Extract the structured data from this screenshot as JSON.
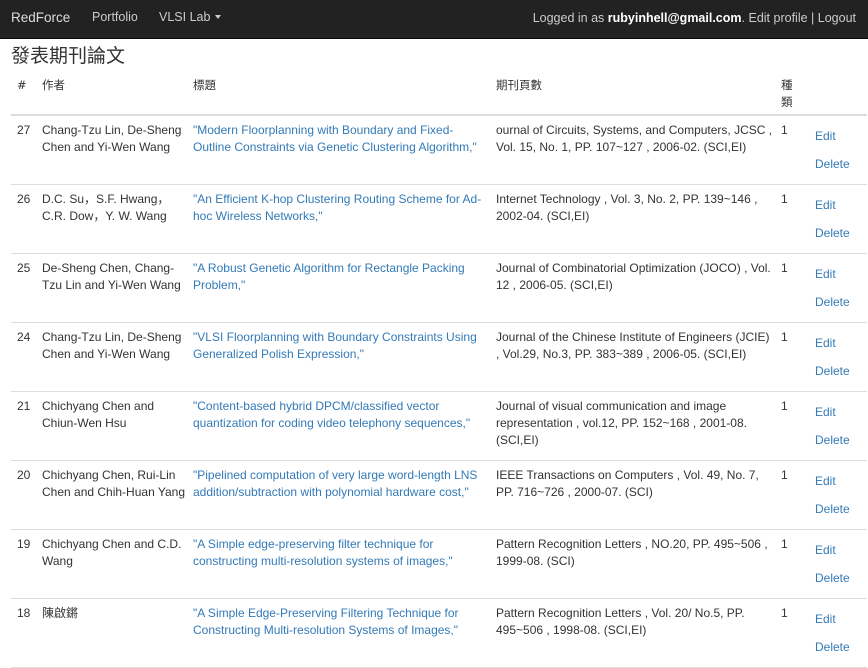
{
  "navbar": {
    "brand": "RedForce",
    "portfolio": "Portfolio",
    "vlsi_lab": "VLSI Lab",
    "logged_in_prefix": "Logged in as",
    "email": "rubyinhell@gmail.com",
    "period": ".",
    "edit_profile": "Edit profile",
    "separator": "|",
    "logout": "Logout"
  },
  "page": {
    "title": "發表期刊論文"
  },
  "table": {
    "headers": {
      "num": "#",
      "author": "作者",
      "title": "標題",
      "journal": "期刊頁數",
      "type_line1": "種",
      "type_line2": "類"
    },
    "rows": [
      {
        "num": "27",
        "author": "Chang-Tzu Lin, De-Sheng Chen and Yi-Wen Wang",
        "title": "\"Modern Floorplanning with Boundary and Fixed-Outline Constraints via Genetic Clustering Algorithm,\"",
        "journal": "ournal of Circuits, Systems, and Computers, JCSC , Vol. 15, No. 1, PP. 107~127 , 2006-02. (SCI,EI)",
        "type": "1",
        "edit": "Edit",
        "delete": "Delete"
      },
      {
        "num": "26",
        "author": "D.C. Su，S.F. Hwang，C.R. Dow，Y. W. Wang",
        "title": "\"An Efficient K-hop Clustering Routing Scheme for Ad-hoc Wireless Networks,\"",
        "journal": "Internet Technology , Vol. 3, No. 2, PP. 139~146 , 2002-04. (SCI,EI)",
        "type": "1",
        "edit": "Edit",
        "delete": "Delete"
      },
      {
        "num": "25",
        "author": "De-Sheng Chen, Chang-Tzu Lin and Yi-Wen Wang",
        "title": "\"A Robust Genetic Algorithm for Rectangle Packing Problem,\"",
        "journal": "Journal of Combinatorial Optimization (JOCO) , Vol. 12 , 2006-05. (SCI,EI)",
        "type": "1",
        "edit": "Edit",
        "delete": "Delete"
      },
      {
        "num": "24",
        "author": "Chang-Tzu Lin, De-Sheng Chen and Yi-Wen Wang",
        "title": "\"VLSI Floorplanning with Boundary Constraints Using Generalized Polish Expression,\"",
        "journal": "Journal of the Chinese Institute of Engineers (JCIE) , Vol.29, No.3, PP. 383~389 , 2006-05. (SCI,EI)",
        "type": "1",
        "edit": "Edit",
        "delete": "Delete"
      },
      {
        "num": "21",
        "author": "Chichyang Chen and Chiun-Wen Hsu",
        "title": "\"Content-based hybrid DPCM/classified vector quantization for coding video telephony sequences,\"",
        "journal": "Journal of visual communication and image representation , vol.12, PP. 152~168 , 2001-08. (SCI,EI)",
        "type": "1",
        "edit": "Edit",
        "delete": "Delete"
      },
      {
        "num": "20",
        "author": "Chichyang Chen, Rui-Lin Chen and Chih-Huan Yang",
        "title": "\"Pipelined computation of very large word-length LNS addition/subtraction with polynomial hardware cost,\"",
        "journal": "IEEE Transactions on Computers , Vol. 49, No. 7, PP. 716~726 , 2000-07. (SCI)",
        "type": "1",
        "edit": "Edit",
        "delete": "Delete"
      },
      {
        "num": "19",
        "author": "Chichyang Chen and C.D. Wang",
        "title": "\"A Simple edge-preserving filter technique for constructing multi-resolution systems of images,\"",
        "journal": "Pattern Recognition Letters , NO.20, PP. 495~506 , 1999-08. (SCI)",
        "type": "1",
        "edit": "Edit",
        "delete": "Delete"
      },
      {
        "num": "18",
        "author": "陳啟鏘",
        "title": "\"A Simple Edge-Preserving Filtering Technique for Constructing Multi-resolution Systems of Images,\"",
        "journal": "Pattern Recognition Letters , Vol. 20/ No.5, PP. 495~506 , 1998-08. (SCI,EI)",
        "type": "1",
        "edit": "Edit",
        "delete": "Delete"
      }
    ]
  }
}
